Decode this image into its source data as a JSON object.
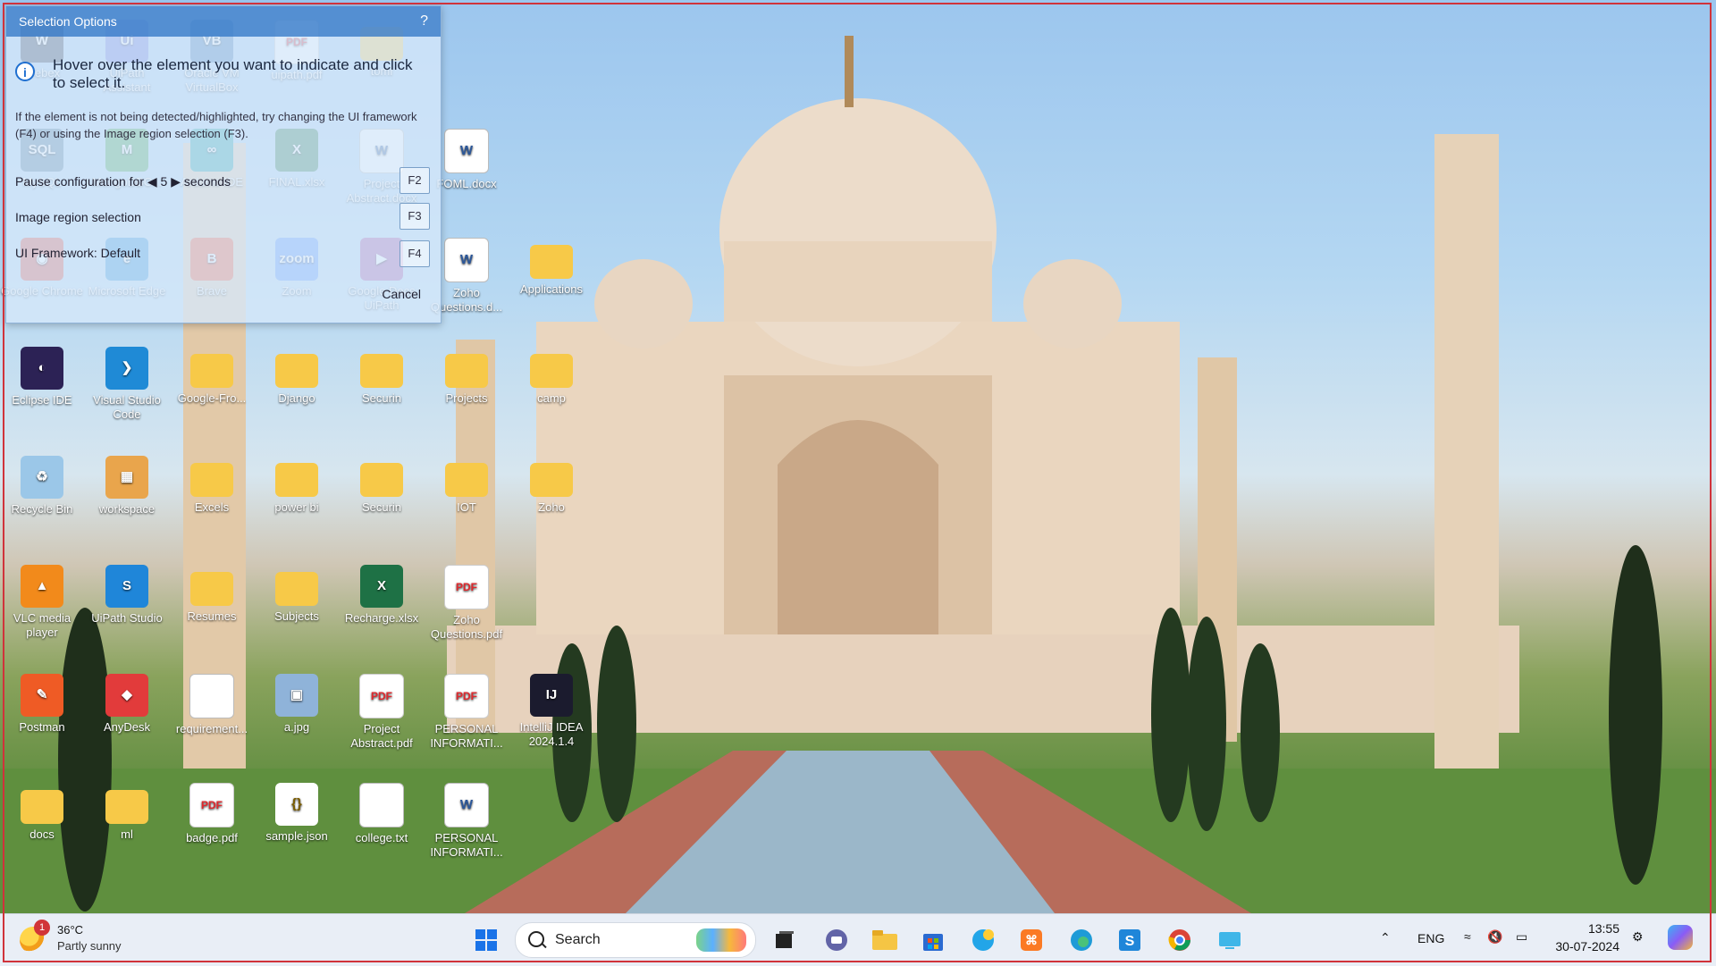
{
  "desktop": {
    "icons": [
      {
        "label": "Webex",
        "glyph": "W",
        "color": "#1e2a44"
      },
      {
        "label": "UiPath Assistant",
        "glyph": "Ui",
        "color": "#5b6cd9"
      },
      {
        "label": "Oracle VM VirtualBox",
        "glyph": "VB",
        "color": "#2f6fb0"
      },
      {
        "label": "uipath.pdf",
        "glyph": "PDF",
        "color": "#ffffff"
      },
      {
        "label": "tomi",
        "glyph": "",
        "color": "#f7c948"
      },
      {
        "label": "MySQL",
        "glyph": "SQL",
        "color": "#3d6e93"
      },
      {
        "label": "MongoDBC...",
        "glyph": "M",
        "color": "#2f9a47"
      },
      {
        "label": "Arduino IDE",
        "glyph": "∞",
        "color": "#12999f"
      },
      {
        "label": "FINAL.xlsx",
        "glyph": "X",
        "color": "#1e7145"
      },
      {
        "label": "Project Abstract.docx",
        "glyph": "W",
        "color": "#ffffff"
      },
      {
        "label": "FOML.docx",
        "glyph": "W",
        "color": "#ffffff"
      },
      {
        "label": "Google Chrome",
        "glyph": "◉",
        "color": "#db4437"
      },
      {
        "label": "Microsoft Edge",
        "glyph": "e",
        "color": "#1c8ad6"
      },
      {
        "label": "Brave",
        "glyph": "B",
        "color": "#fb542b"
      },
      {
        "label": "Zoom",
        "glyph": "zoom",
        "color": "#4a8cff"
      },
      {
        "label": "Google Docs UiPath",
        "glyph": "▶",
        "color": "#a04aa0"
      },
      {
        "label": "Zoho Questions.d...",
        "glyph": "W",
        "color": "#ffffff"
      },
      {
        "label": "Applications",
        "glyph": "",
        "color": "#f7c948"
      },
      {
        "label": "Eclipse IDE",
        "glyph": "◐",
        "color": "#2c2255"
      },
      {
        "label": "Visual Studio Code",
        "glyph": "❯",
        "color": "#1f8ad6"
      },
      {
        "label": "Google-Fro...",
        "glyph": "",
        "color": "#f7c948"
      },
      {
        "label": "Django",
        "glyph": "",
        "color": "#f7c948"
      },
      {
        "label": "Securin",
        "glyph": "",
        "color": "#f7c948"
      },
      {
        "label": "Projects",
        "glyph": "",
        "color": "#f7c948"
      },
      {
        "label": "camp",
        "glyph": "",
        "color": "#f7c948"
      },
      {
        "label": "Recycle Bin",
        "glyph": "♻",
        "color": "#9bc7e8"
      },
      {
        "label": "workspace",
        "glyph": "▦",
        "color": "#e9a54c"
      },
      {
        "label": "Excels",
        "glyph": "",
        "color": "#f7c948"
      },
      {
        "label": "power bi",
        "glyph": "",
        "color": "#f7c948"
      },
      {
        "label": "Securin",
        "glyph": "",
        "color": "#f7c948"
      },
      {
        "label": "IOT",
        "glyph": "",
        "color": "#f7c948"
      },
      {
        "label": "Zoho",
        "glyph": "",
        "color": "#f7c948"
      },
      {
        "label": "VLC media player",
        "glyph": "▲",
        "color": "#f28a1b"
      },
      {
        "label": "UiPath Studio",
        "glyph": "S",
        "color": "#1f86d9"
      },
      {
        "label": "Resumes",
        "glyph": "",
        "color": "#f7c948"
      },
      {
        "label": "Subjects",
        "glyph": "",
        "color": "#f7c948"
      },
      {
        "label": "Recharge.xlsx",
        "glyph": "X",
        "color": "#1e7145"
      },
      {
        "label": "Zoho Questions.pdf",
        "glyph": "PDF",
        "color": "#ffffff"
      },
      {
        "label": "Postman",
        "glyph": "✎",
        "color": "#ef5b25"
      },
      {
        "label": "AnyDesk",
        "glyph": "◆",
        "color": "#e23b3b"
      },
      {
        "label": "requirement...",
        "glyph": "",
        "color": "#ffffff"
      },
      {
        "label": "a.jpg",
        "glyph": "▣",
        "color": "#8fb3d9"
      },
      {
        "label": "Project Abstract.pdf",
        "glyph": "PDF",
        "color": "#ffffff"
      },
      {
        "label": "PERSONAL INFORMATI...",
        "glyph": "PDF",
        "color": "#ffffff"
      },
      {
        "label": "IntelliJ IDEA 2024.1.4",
        "glyph": "IJ",
        "color": "#1b1b2e"
      },
      {
        "label": "docs",
        "glyph": "",
        "color": "#f7c948"
      },
      {
        "label": "ml",
        "glyph": "",
        "color": "#f7c948"
      },
      {
        "label": "badge.pdf",
        "glyph": "PDF",
        "color": "#ffffff"
      },
      {
        "label": "sample.json",
        "glyph": "{}",
        "color": "#ffffff"
      },
      {
        "label": "college.txt",
        "glyph": "",
        "color": "#ffffff"
      },
      {
        "label": "PERSONAL INFORMATI...",
        "glyph": "W",
        "color": "#ffffff"
      }
    ]
  },
  "selection_dialog": {
    "title": "Selection Options",
    "help": "?",
    "main_message": "Hover over the element you want to indicate and click to select it.",
    "sub_message": "If the element is not being detected/highlighted, try changing the UI framework (F4) or using the Image region selection (F3).",
    "pause_label_pre": "Pause configuration for",
    "pause_value": "5",
    "pause_label_post": "seconds",
    "pause_key": "F2",
    "image_region_label": "Image region selection",
    "image_region_key": "F3",
    "ui_framework_label": "UI Framework: Default",
    "ui_framework_key": "F4",
    "cancel_label": "Cancel"
  },
  "taskbar": {
    "weather": {
      "temp": "36°C",
      "condition": "Partly sunny",
      "badge": "1"
    },
    "search_placeholder": "Search",
    "apps": [
      "windows-start-icon",
      "task-view-icon",
      "chat-icon",
      "file-explorer-icon",
      "store-icon",
      "copilot-help-icon",
      "xampp-icon",
      "edge-icon",
      "uipath-studio-icon",
      "chrome-icon",
      "remote-desktop-icon"
    ],
    "tray": {
      "language": "ENG",
      "time": "13:55",
      "date": "30-07-2024"
    }
  }
}
